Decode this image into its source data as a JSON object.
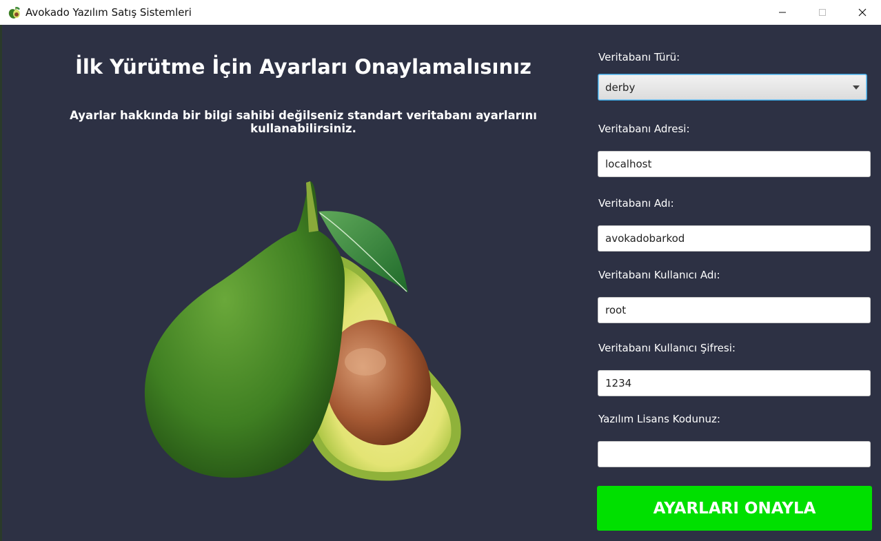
{
  "window": {
    "title": "Avokado Yazılım Satış Sistemleri",
    "app_icon": "avocado-icon",
    "controls": [
      "minimize-icon",
      "maximize-icon",
      "close-icon"
    ]
  },
  "main": {
    "heading": "İlk Yürütme İçin Ayarları Onaylamalısınız",
    "subheading": "Ayarlar hakkında bir bilgi sahibi değilseniz standart veritabanı ayarlarını kullanabilirsiniz."
  },
  "form": {
    "db_type": {
      "label": "Veritabanı Türü:",
      "value": "derby"
    },
    "db_address": {
      "label": "Veritabanı Adresi:",
      "value": "localhost"
    },
    "db_name": {
      "label": "Veritabanı Adı:",
      "value": "avokadobarkod"
    },
    "db_user": {
      "label": "Veritabanı Kullanıcı Adı:",
      "value": "root"
    },
    "db_password": {
      "label": "Veritabanı Kullanıcı Şifresi:",
      "value": "1234"
    },
    "license": {
      "label": "Yazılım Lisans Kodunuz:",
      "value": ""
    },
    "submit_label": "AYARLARI ONAYLA"
  },
  "colors": {
    "background": "#2d3144",
    "accent_button": "#00e000",
    "focus_border": "#39a0d8"
  }
}
